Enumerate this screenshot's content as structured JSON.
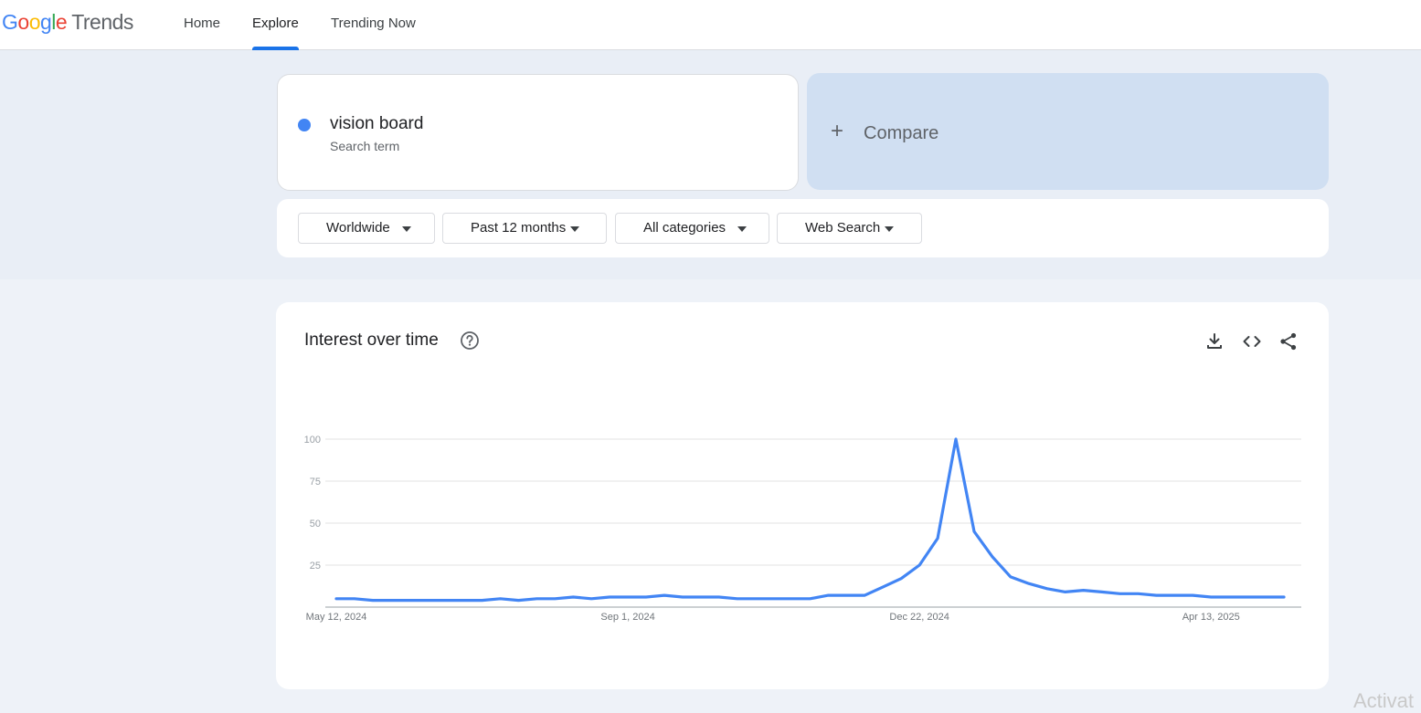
{
  "header": {
    "logo": {
      "letters": [
        "G",
        "o",
        "o",
        "g",
        "l",
        "e"
      ],
      "product": "Trends"
    },
    "nav": [
      {
        "label": "Home",
        "active": false
      },
      {
        "label": "Explore",
        "active": true
      },
      {
        "label": "Trending Now",
        "active": false
      }
    ]
  },
  "search": {
    "term": "vision board",
    "term_type": "Search term",
    "term_color": "#4285f4",
    "compare_label": "Compare"
  },
  "filters": [
    {
      "label": "Worldwide"
    },
    {
      "label": "Past 12 months"
    },
    {
      "label": "All categories"
    },
    {
      "label": "Web Search"
    }
  ],
  "interest_card": {
    "title": "Interest over time",
    "icons": [
      "help-icon",
      "download-icon",
      "embed-icon",
      "share-icon"
    ]
  },
  "chart_data": {
    "type": "line",
    "title": "Interest over time",
    "xlabel": "",
    "ylabel": "",
    "ylim": [
      0,
      100
    ],
    "yticks": [
      25,
      50,
      75,
      100
    ],
    "xtick_labels": [
      "May 12, 2024",
      "Sep 1, 2024",
      "Dec 22, 2024",
      "Apr 13, 2025"
    ],
    "grid": true,
    "series": [
      {
        "color": "#4285f4",
        "x": [
          "2024-05-12",
          "2024-05-19",
          "2024-05-26",
          "2024-06-02",
          "2024-06-09",
          "2024-06-16",
          "2024-06-23",
          "2024-06-30",
          "2024-07-07",
          "2024-07-14",
          "2024-07-21",
          "2024-07-28",
          "2024-08-04",
          "2024-08-11",
          "2024-08-18",
          "2024-08-25",
          "2024-09-01",
          "2024-09-08",
          "2024-09-15",
          "2024-09-22",
          "2024-09-29",
          "2024-10-06",
          "2024-10-13",
          "2024-10-20",
          "2024-10-27",
          "2024-11-03",
          "2024-11-10",
          "2024-11-17",
          "2024-11-24",
          "2024-12-01",
          "2024-12-08",
          "2024-12-15",
          "2024-12-22",
          "2024-12-29",
          "2025-01-05",
          "2025-01-12",
          "2025-01-19",
          "2025-01-26",
          "2025-02-02",
          "2025-02-09",
          "2025-02-16",
          "2025-02-23",
          "2025-03-02",
          "2025-03-09",
          "2025-03-16",
          "2025-03-23",
          "2025-03-30",
          "2025-04-06",
          "2025-04-13",
          "2025-04-20",
          "2025-04-27",
          "2025-05-04",
          "2025-05-11"
        ],
        "values": [
          5,
          5,
          4,
          4,
          4,
          4,
          4,
          4,
          4,
          5,
          4,
          5,
          5,
          6,
          5,
          6,
          6,
          6,
          7,
          6,
          6,
          6,
          5,
          5,
          5,
          5,
          5,
          7,
          7,
          7,
          12,
          17,
          25,
          41,
          100,
          45,
          30,
          18,
          14,
          11,
          9,
          10,
          9,
          8,
          8,
          7,
          7,
          7,
          6,
          6,
          6,
          6,
          6
        ]
      }
    ]
  },
  "watermark": "Activat"
}
